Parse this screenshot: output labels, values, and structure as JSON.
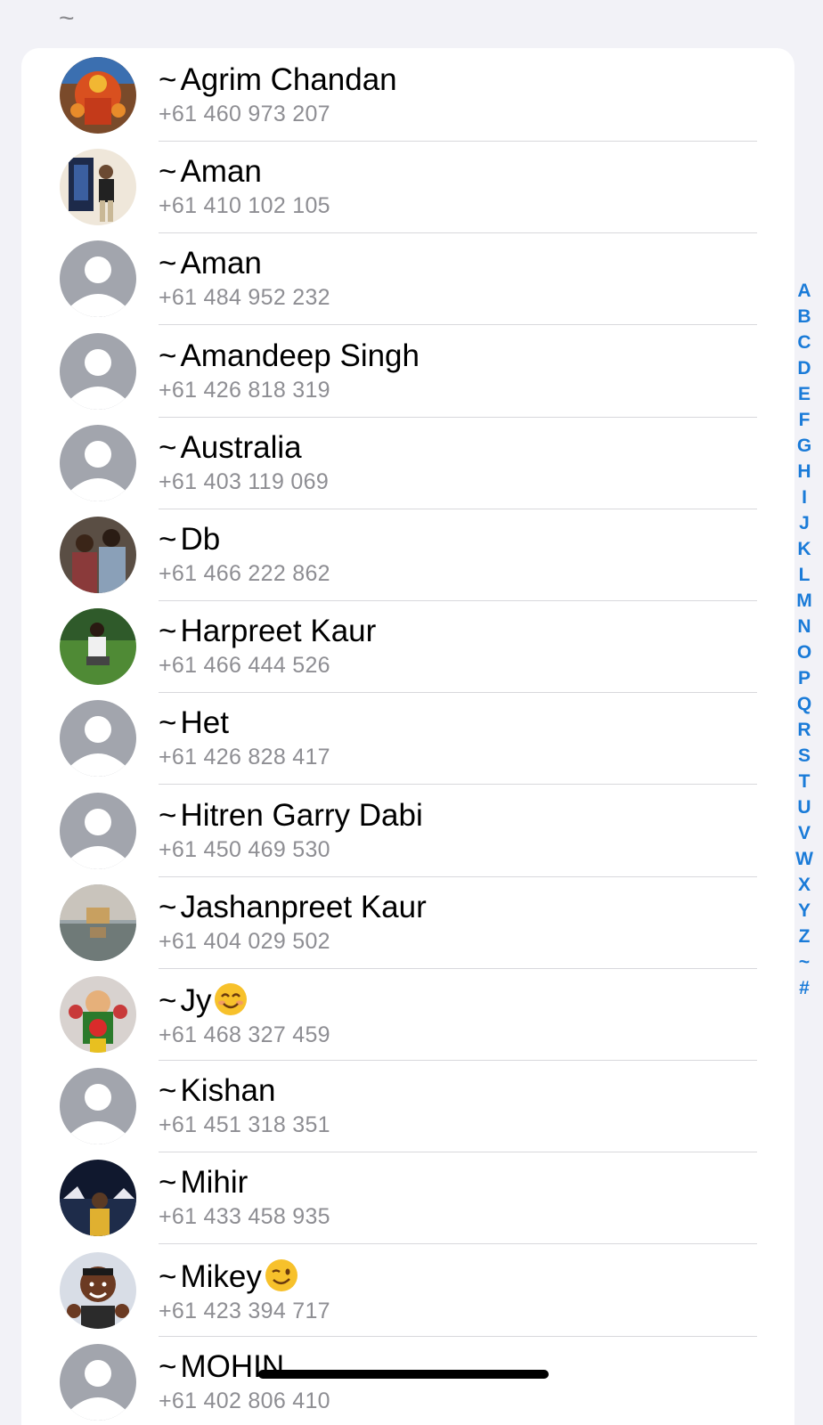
{
  "section_header": "~",
  "contacts": [
    {
      "name": "Agrim Chandan",
      "phone": "+61 460 973 207",
      "avatar": "photo-deity-orange"
    },
    {
      "name": "Aman",
      "phone": "+61 410 102 105",
      "avatar": "photo-man-standing"
    },
    {
      "name": "Aman",
      "phone": "+61 484 952 232",
      "avatar": "default-person-icon"
    },
    {
      "name": "Amandeep Singh",
      "phone": "+61 426 818 319",
      "avatar": "default-person-icon"
    },
    {
      "name": "Australia",
      "phone": "+61 403 119 069",
      "avatar": "default-person-icon"
    },
    {
      "name": "Db",
      "phone": "+61 466 222 862",
      "avatar": "photo-couple"
    },
    {
      "name": "Harpreet Kaur",
      "phone": "+61 466 444 526",
      "avatar": "photo-woman-grass"
    },
    {
      "name": "Het",
      "phone": "+61 426 828 417",
      "avatar": "default-person-icon"
    },
    {
      "name": "Hitren Garry Dabi",
      "phone": "+61 450 469 530",
      "avatar": "default-person-icon"
    },
    {
      "name": "Jashanpreet Kaur",
      "phone": "+61 404 029 502",
      "avatar": "photo-temple"
    },
    {
      "name": "Jy",
      "phone": "+61 468 327 459",
      "avatar": "photo-deity-colorful",
      "emoji": "smiling-face-emoji"
    },
    {
      "name": "Kishan",
      "phone": "+61 451 318 351",
      "avatar": "default-person-icon"
    },
    {
      "name": "Mihir",
      "phone": "+61 433 458 935",
      "avatar": "photo-night-city"
    },
    {
      "name": "Mikey",
      "phone": "+61 423 394 717",
      "avatar": "memoji-thumbs-up",
      "emoji": "winking-face-emoji"
    },
    {
      "name": "MOHIN",
      "phone": "+61 402 806 410",
      "avatar": "default-person-icon"
    }
  ],
  "tilde": "~",
  "index_letters": [
    "A",
    "B",
    "C",
    "D",
    "E",
    "F",
    "G",
    "H",
    "I",
    "J",
    "K",
    "L",
    "M",
    "N",
    "O",
    "P",
    "Q",
    "R",
    "S",
    "T",
    "U",
    "V",
    "W",
    "X",
    "Y",
    "Z",
    "~",
    "#"
  ],
  "colors": {
    "accent": "#1a7bd8",
    "background": "#f2f2f7",
    "secondary_text": "#8e8e93",
    "default_avatar": "#a2a5ad"
  }
}
